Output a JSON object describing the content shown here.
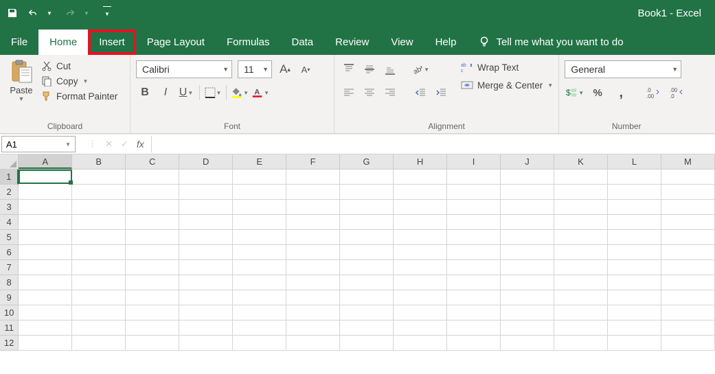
{
  "title": "Book1  -  Excel",
  "qat": {
    "undo_disabled": false,
    "redo_disabled": true
  },
  "tabs": [
    {
      "label": "File"
    },
    {
      "label": "Home",
      "active": true
    },
    {
      "label": "Insert",
      "highlighted": true
    },
    {
      "label": "Page Layout"
    },
    {
      "label": "Formulas"
    },
    {
      "label": "Data"
    },
    {
      "label": "Review"
    },
    {
      "label": "View"
    },
    {
      "label": "Help"
    }
  ],
  "tellme": "Tell me what you want to do",
  "ribbon": {
    "clipboard": {
      "group_label": "Clipboard",
      "paste": "Paste",
      "cut": "Cut",
      "copy": "Copy",
      "format_painter": "Format Painter"
    },
    "font": {
      "group_label": "Font",
      "font_name": "Calibri",
      "font_size": "11"
    },
    "alignment": {
      "group_label": "Alignment",
      "wrap_text": "Wrap Text",
      "merge_center": "Merge & Center"
    },
    "number": {
      "group_label": "Number",
      "format": "General"
    }
  },
  "formula_bar": {
    "cell_ref": "A1",
    "value": ""
  },
  "grid": {
    "columns": [
      "A",
      "B",
      "C",
      "D",
      "E",
      "F",
      "G",
      "H",
      "I",
      "J",
      "K",
      "L",
      "M"
    ],
    "rows": [
      1,
      2,
      3,
      4,
      5,
      6,
      7,
      8,
      9,
      10,
      11,
      12
    ],
    "selected": {
      "col": "A",
      "row": 1
    }
  }
}
